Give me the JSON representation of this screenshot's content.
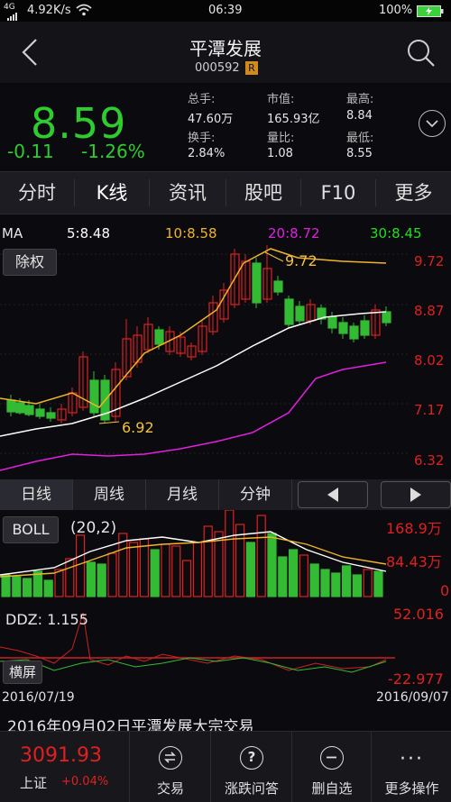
{
  "status_bar": {
    "network": "4G",
    "speed": "4.92K/s",
    "time": "06:39",
    "battery": "100%"
  },
  "header": {
    "title": "平潭发展",
    "code": "000592",
    "badge": "R"
  },
  "quote": {
    "price": "8.59",
    "change": "-0.11",
    "change_pct": "-1.26%",
    "stats": [
      {
        "label": "总手:",
        "value": "47.60万"
      },
      {
        "label": "市值:",
        "value": "165.93亿"
      },
      {
        "label": "最高:",
        "value": "8.84"
      },
      {
        "label": "换手:",
        "value": "2.84%"
      },
      {
        "label": "量比:",
        "value": "1.08"
      },
      {
        "label": "最低:",
        "value": "8.55"
      }
    ]
  },
  "tabs": [
    "分时",
    "K线",
    "资讯",
    "股吧",
    "F10",
    "更多"
  ],
  "ma": {
    "label": "MA",
    "ma5": "5:8.48",
    "ma10": "10:8.58",
    "ma20": "20:8.72",
    "ma30": "30:8.45",
    "colors": {
      "ma5": "#ffffff",
      "ma10": "#f0b429",
      "ma20": "#e020e0",
      "ma30": "#22dd22"
    }
  },
  "kline": {
    "adjust_button": "除权",
    "y_labels": [
      "9.72",
      "8.87",
      "8.02",
      "7.17",
      "6.32"
    ],
    "high_annot": "9.72",
    "low_annot": "6.92",
    "colors": {
      "up": "#e02020",
      "down": "#33bb33"
    }
  },
  "period_tabs": [
    "日线",
    "周线",
    "月线",
    "分钟"
  ],
  "volume": {
    "indicator_button": "BOLL",
    "params": "(20,2)",
    "y_labels": [
      "168.9万",
      "84.43万",
      "0"
    ]
  },
  "ddz": {
    "label": "DDZ: 1.155",
    "button": "横屏",
    "y_top": "52.016",
    "y_bottom": "-22.977"
  },
  "dates": {
    "start": "2016/07/19",
    "end": "2016/09/07"
  },
  "news_headline": "2016年09月02日平潭发展大宗交易",
  "bottom_bar": {
    "index_value": "3091.93",
    "index_name": "上证",
    "index_change": "+0.04%",
    "buttons": [
      "交易",
      "涨跌问答",
      "删自选",
      "更多操作"
    ]
  }
}
